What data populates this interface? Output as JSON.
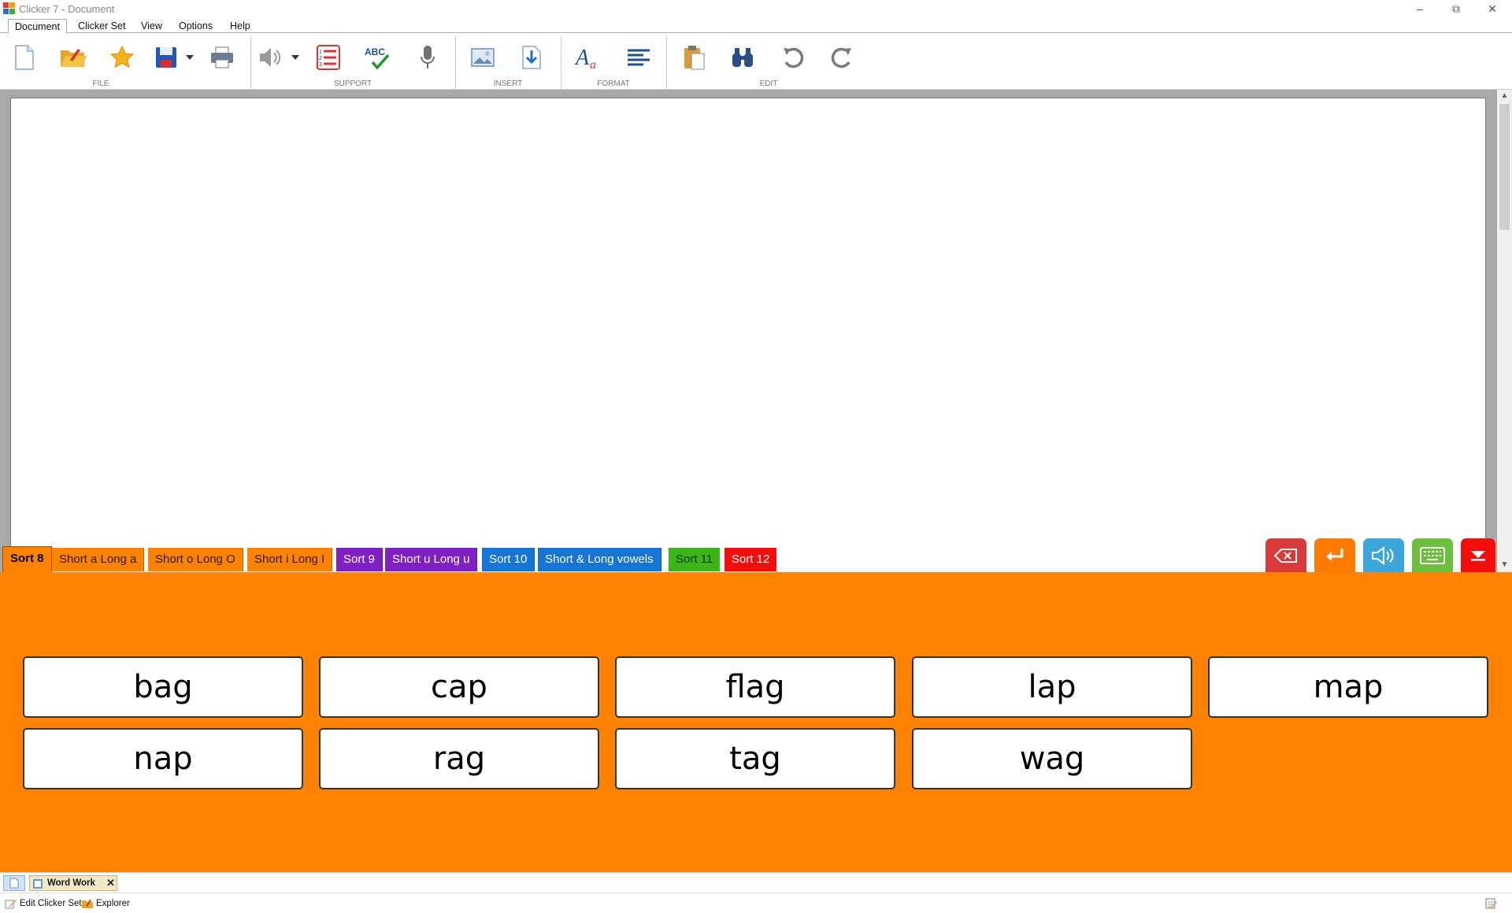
{
  "window": {
    "title": "Clicker 7 - Document"
  },
  "menu": {
    "document": "Document",
    "clicker_set": "Clicker Set",
    "view": "View",
    "options": "Options",
    "help": "Help"
  },
  "ribbon": {
    "groups": {
      "file": "FILE",
      "support": "SUPPORT",
      "insert": "INSERT",
      "format": "FORMAT",
      "edit": "EDIT"
    }
  },
  "tabs": [
    {
      "label": "Sort 8",
      "color": "#ff8200"
    },
    {
      "label": "Short a Long a",
      "color": "#ff8200"
    },
    {
      "label": "Short o Long O",
      "color": "#ff8200"
    },
    {
      "label": "Short i Long I",
      "color": "#ff8200"
    },
    {
      "label": "Sort 9",
      "color": "#7f1fc4"
    },
    {
      "label": "Short u Long u",
      "color": "#7f1fc4"
    },
    {
      "label": "Sort 10",
      "color": "#1775d6"
    },
    {
      "label": "Short & Long vowels",
      "color": "#1775d6"
    },
    {
      "label": "Sort 11",
      "color": "#3bb519"
    },
    {
      "label": "Sort 12",
      "color": "#f40d0d"
    }
  ],
  "controls": [
    {
      "icon": "backspace-icon",
      "color": "#d93a3a"
    },
    {
      "icon": "enter-icon",
      "color": "#ff7a00"
    },
    {
      "icon": "speak-icon",
      "color": "#3aa6dc"
    },
    {
      "icon": "keyboard-icon",
      "color": "#6cbf3a"
    },
    {
      "icon": "collapse-icon",
      "color": "#f40d0d"
    }
  ],
  "grid": {
    "background": "#ff8200",
    "row1": [
      "bag",
      "cap",
      "flag",
      "lap",
      "map"
    ],
    "row2": [
      "nap",
      "rag",
      "tag",
      "wag"
    ]
  },
  "docbar": {
    "tab_label": "Word Work"
  },
  "statusbar": {
    "edit_clicker_set": "Edit Clicker Set",
    "explorer": "Explorer"
  }
}
